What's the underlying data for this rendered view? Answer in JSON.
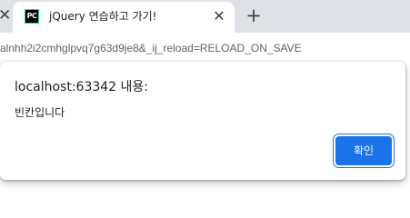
{
  "tabstrip": {
    "prev_tab_close_icon": "close-icon",
    "tab": {
      "favicon_icon": "pycharm-icon",
      "favicon_text": "PC",
      "title": "jQuery 연습하고 가기!",
      "close_icon": "close-icon"
    },
    "new_tab_icon": "plus-icon"
  },
  "address_bar": {
    "url": "alnhh2i2cmhglpvq7g63d9je8&_ij_reload=RELOAD_ON_SAVE"
  },
  "dialog": {
    "title": "localhost:63342 내용:",
    "message": "빈칸입니다",
    "ok_label": "확인",
    "accent_color": "#1a73e8"
  }
}
